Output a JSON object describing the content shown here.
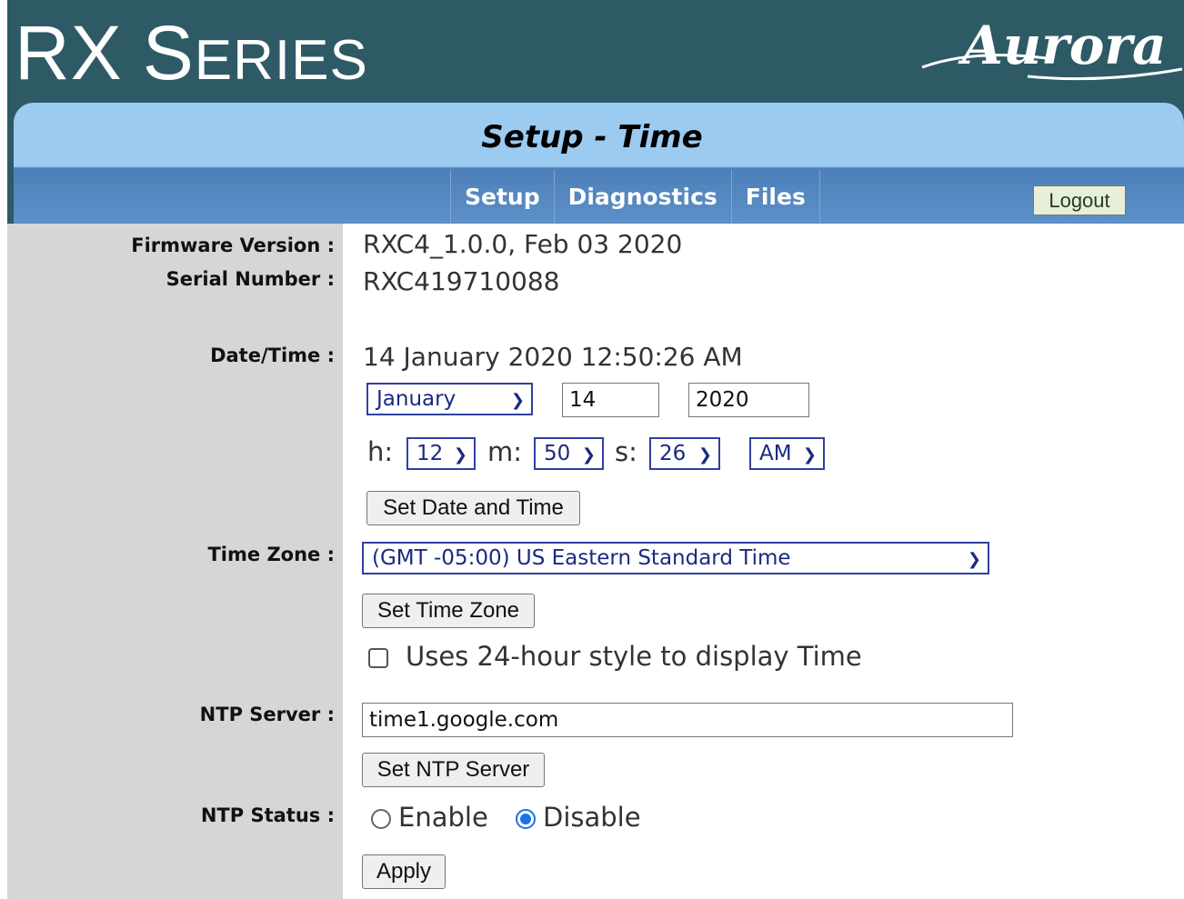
{
  "header": {
    "product_title_big_r": "R",
    "product_title_big_x": "X",
    "product_title_big_s": "S",
    "product_title_small": "ERIES",
    "brand_logo_text": "Aurora"
  },
  "page": {
    "heading": "Setup - Time"
  },
  "nav": {
    "tabs": [
      "Setup",
      "Diagnostics",
      "Files"
    ],
    "logout_label": "Logout"
  },
  "info": {
    "firmware_label": "Firmware Version :",
    "firmware_value": "RXC4_1.0.0, Feb 03 2020",
    "serial_label": "Serial Number :",
    "serial_value": "RXC419710088"
  },
  "datetime": {
    "label": "Date/Time :",
    "current_value": "14 January 2020 12:50:26 AM",
    "month": "January",
    "day": "14",
    "year": "2020",
    "hour_label": "h:",
    "hour": "12",
    "minute_label": "m:",
    "minute": "50",
    "second_label": "s:",
    "second": "26",
    "ampm": "AM",
    "set_button": "Set Date and Time"
  },
  "timezone": {
    "label": "Time Zone :",
    "selected": "(GMT -05:00) US Eastern Standard Time",
    "set_button": "Set Time Zone",
    "hour24_label": "Uses 24-hour style to display Time",
    "hour24_checked": false
  },
  "ntp": {
    "server_label": "NTP Server :",
    "server_value": "time1.google.com",
    "set_server_button": "Set NTP Server",
    "status_label": "NTP Status :",
    "enable_label": "Enable",
    "disable_label": "Disable",
    "selected": "Disable",
    "apply_button": "Apply"
  },
  "colors": {
    "banner": "#2e5a66",
    "title_panel": "#9ccbf2",
    "nav_bar": "#5d90c8",
    "label_column": "#d6d6d6",
    "select_border": "#3040a0"
  },
  "icons": {
    "select_arrow": "chevron-down-icon"
  }
}
